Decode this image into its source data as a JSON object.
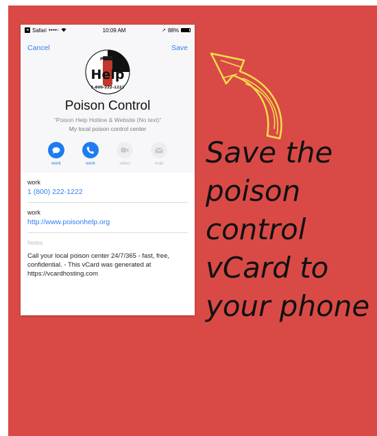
{
  "status_bar": {
    "carrier": "Safari",
    "signal": "●●●●○",
    "time": "10:09 AM",
    "battery": "88%",
    "battery_level": 0.88
  },
  "nav": {
    "cancel_label": "Cancel",
    "save_label": "Save"
  },
  "contact": {
    "name": "Poison Control",
    "subtitle": "“Poison Help Hotline & Website (No text)”",
    "description": "My local poison control center",
    "logo": {
      "top_text": "POISON",
      "main_text": "Help",
      "bottom_text": "1-800-222-1222"
    }
  },
  "actions": [
    {
      "icon": "message-icon",
      "label": "work",
      "active": true
    },
    {
      "icon": "phone-icon",
      "label": "work",
      "active": true
    },
    {
      "icon": "video-icon",
      "label": "video",
      "active": false
    },
    {
      "icon": "mail-icon",
      "label": "mail",
      "active": false
    }
  ],
  "fields": [
    {
      "label": "work",
      "value": "1 (800) 222-1222"
    },
    {
      "label": "work",
      "value": "http://www.poisonhelp.org"
    }
  ],
  "notes": {
    "label": "Notes",
    "text": "Call your local poison center 24/7/365 - fast, free, confidential. - This vCard was generated at https://vcardhosting.com"
  },
  "caption": {
    "lines": [
      "Save the",
      "poison",
      "control",
      "vCard to",
      "your phone"
    ]
  },
  "colors": {
    "background": "#d94a46",
    "accent": "#2f7ef0",
    "arrow": "#f5e04a"
  }
}
